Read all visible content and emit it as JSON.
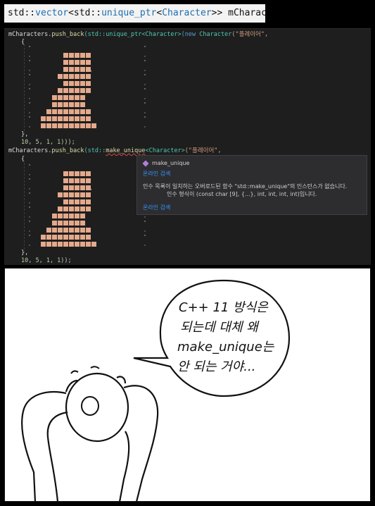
{
  "declaration": {
    "text_prefix": "std::",
    "vector": "vector",
    "mid1": "<std::",
    "unique_ptr": "unique_ptr",
    "mid2": "<",
    "character": "Character",
    "suffix": ">> mCharacters;"
  },
  "code": {
    "line1_prefix": "mCharacters.",
    "line1_fn": "push_back",
    "line1_ns": "(std::unique_ptr",
    "line1_t": "<Character>",
    "line1_kw": "(new ",
    "line1_cls": "Character",
    "line1_str": "(\"플레이어\",",
    "open_brace": "{",
    "close_brace": "},",
    "args1": "10, 5, 1, 1)));",
    "line2_prefix": "mCharacters.",
    "line2_fn": "push_back",
    "line2_ns": "(std::",
    "line2_make": "make_unique",
    "line2_t": "<Character>",
    "line2_str": "(\"플레이어\",",
    "args2": "10, 5, 1, 1));",
    "caret": "^"
  },
  "tooltip": {
    "title": "make_unique",
    "link_top": "온라인 검색",
    "message_line1": "인수 목록이 일치하는 오버로드된 함수 \"std::make_unique\"의 인스턴스가 없습니다.",
    "message_line2": "인수 형식이 (const char [9], {...}, int, int, int, int)입니다.",
    "link_bottom": "온라인 검색"
  },
  "comic": {
    "line1": "C++ 11 방식은",
    "line2": "되는데 대체 왜",
    "line3": "make_unique는",
    "line4": "안 되는 거야..."
  },
  "colors": {
    "editor_bg": "#1e1e1e",
    "pixel_art": "#e5a98b",
    "link": "#3794ff",
    "error_squiggle": "#e04848"
  }
}
